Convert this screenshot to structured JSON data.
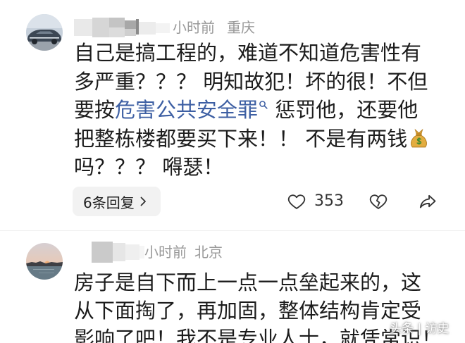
{
  "comments": [
    {
      "time": "小时前",
      "location": "重庆",
      "line_1": "自己是搞工程的，难道不知道危害性有",
      "line_2": "多严重？？？ 明知故犯！坏的很！不但",
      "line_3_before": "要按",
      "line_3_link": "危害公共安全罪",
      "line_3_after": " 惩罚他，还要他",
      "line_4": "把整栋楼都要买下来！！ 不是有两钱",
      "line_4_emoji": "money-bag-icon",
      "line_5": "吗？？？ 嘚瑟！",
      "replies_label": "6条回复",
      "likes": "353"
    },
    {
      "time": "小时前",
      "location": "北京",
      "line_1": "房子是自下而上一点一点垒起来的，这",
      "line_2": "从下面掏了，再加固，整体结构肯定受",
      "line_3": "影响了吧！我不是专业人士，就凭常识！"
    }
  ],
  "watermark": "头条 | 访史",
  "icons": {
    "like": "heart-outline-icon",
    "dislike": "broken-heart-icon",
    "share": "share-arrow-icon",
    "search": "search-icon",
    "chevron": "chevron-right-icon",
    "emoji": "money-bag-icon"
  },
  "colors": {
    "text": "#1c1c1c",
    "meta": "#9a9a9a",
    "link": "#3d5fa3",
    "pill_background": "#f2f2f2",
    "background": "#ffffff"
  }
}
